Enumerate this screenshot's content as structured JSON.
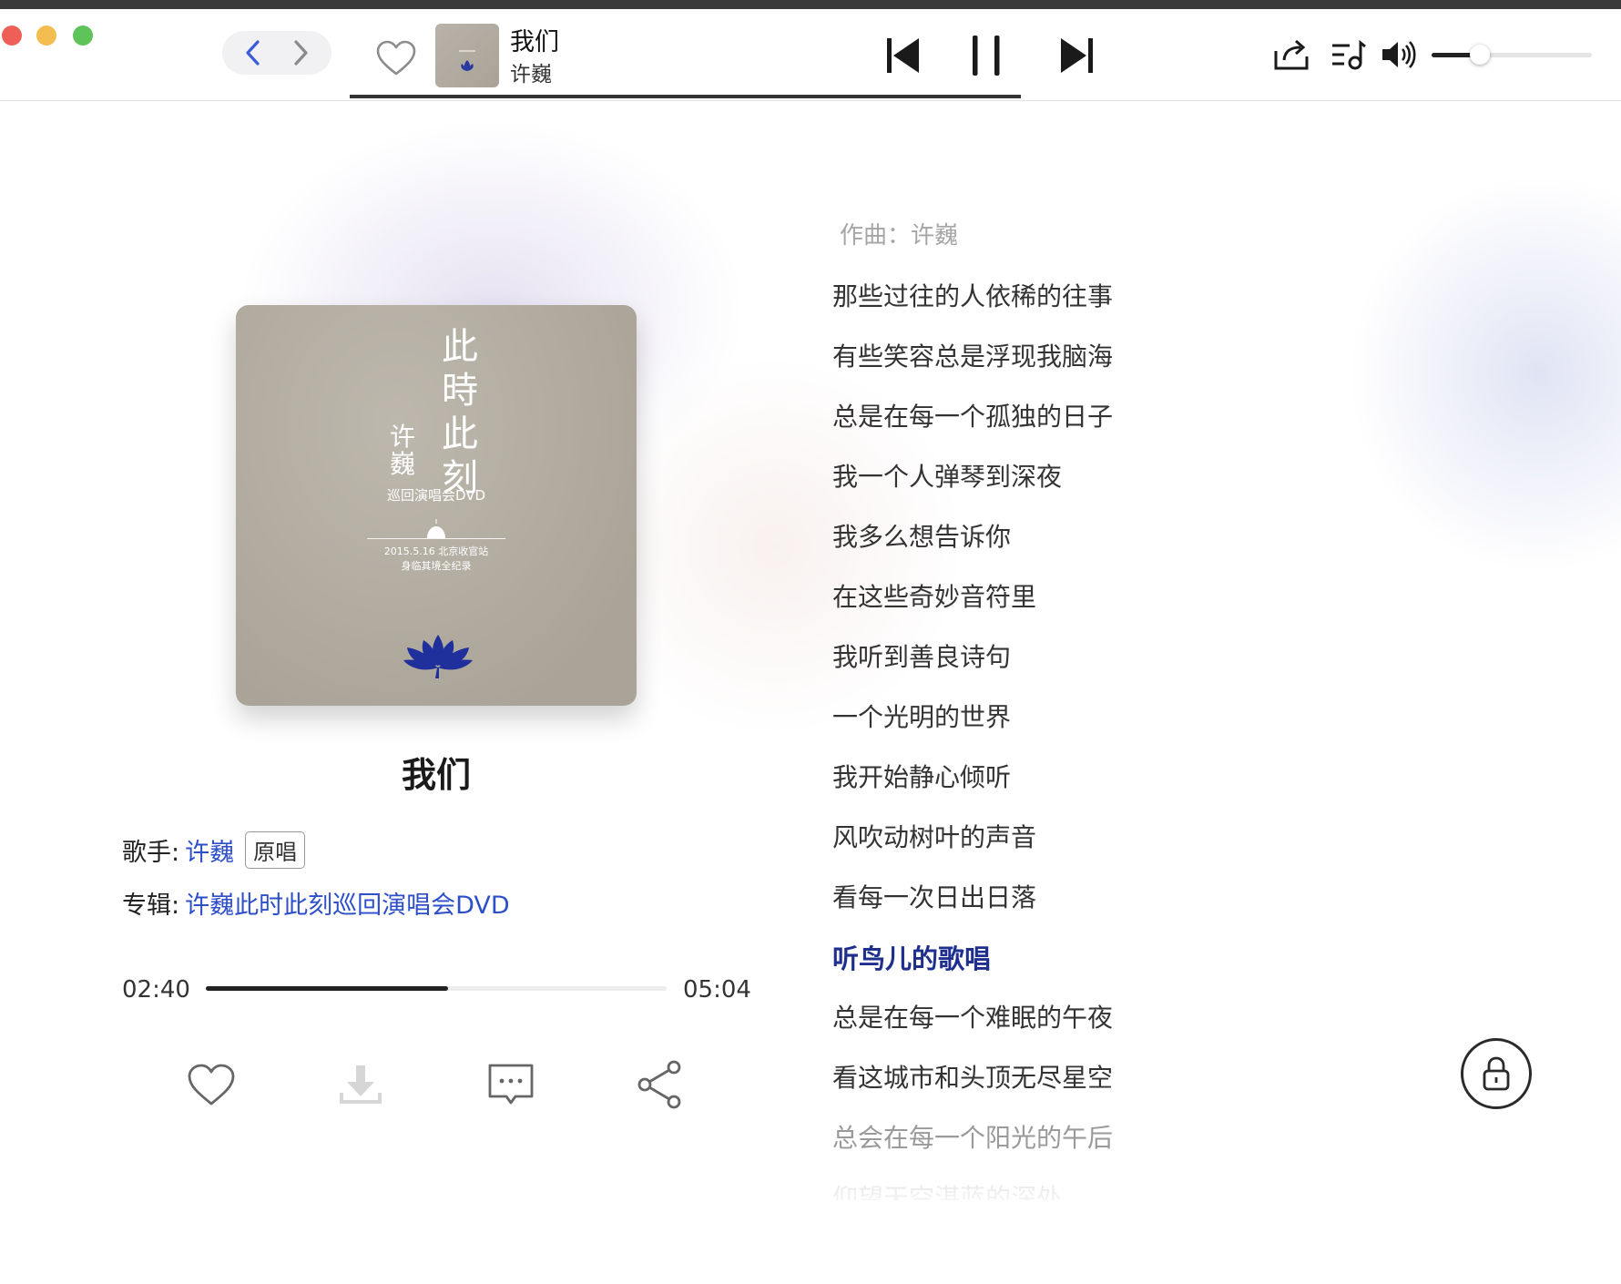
{
  "player": {
    "title": "我们",
    "artist": "许巍",
    "progress": 0.525,
    "volume": 0.3
  },
  "album_art": {
    "calligraphy": "此時此刻",
    "artist_calligraphy": "许巍",
    "subtitle": "巡回演唱会DVD",
    "date_line": "2015.5.16 北京收官站",
    "note_line": "身临其境全纪录"
  },
  "song": {
    "title": "我们",
    "singer_label": "歌手:",
    "singer": "许巍",
    "singer_tag": "原唱",
    "album_label": "专辑:",
    "album": "许巍此时此刻巡回演唱会DVD",
    "current_time": "02:40",
    "total_time": "05:04",
    "progress": 0.525
  },
  "lyrics": [
    "作曲：许巍",
    "那些过往的人依稀的往事",
    "有些笑容总是浮现我脑海",
    "总是在每一个孤独的日子",
    "我一个人弹琴到深夜",
    "我多么想告诉你",
    "在这些奇妙音符里",
    "我听到善良诗句",
    "一个光明的世界",
    "我开始静心倾听",
    "风吹动树叶的声音",
    "看每一次日出日落",
    "听鸟儿的歌唱",
    "总是在每一个难眠的午夜",
    "看这城市和头顶无尽星空",
    "总会在每一个阳光的午后",
    "仰望天空湛蓝的深处"
  ],
  "active_lyric_index": 12,
  "icons": {
    "back": "chevron-left-icon",
    "forward": "chevron-right-icon",
    "like": "heart-icon",
    "prev": "skip-previous-icon",
    "pause": "pause-icon",
    "next": "skip-next-icon",
    "share": "share-icon",
    "playlist": "playlist-icon",
    "volume": "volume-icon",
    "download": "download-icon",
    "comment": "comment-icon",
    "lock": "lock-icon"
  },
  "colors": {
    "accent_link": "#2d4fc9",
    "active_lyric": "#1e2f8e",
    "nav_arrow": "#3b5bdb"
  }
}
